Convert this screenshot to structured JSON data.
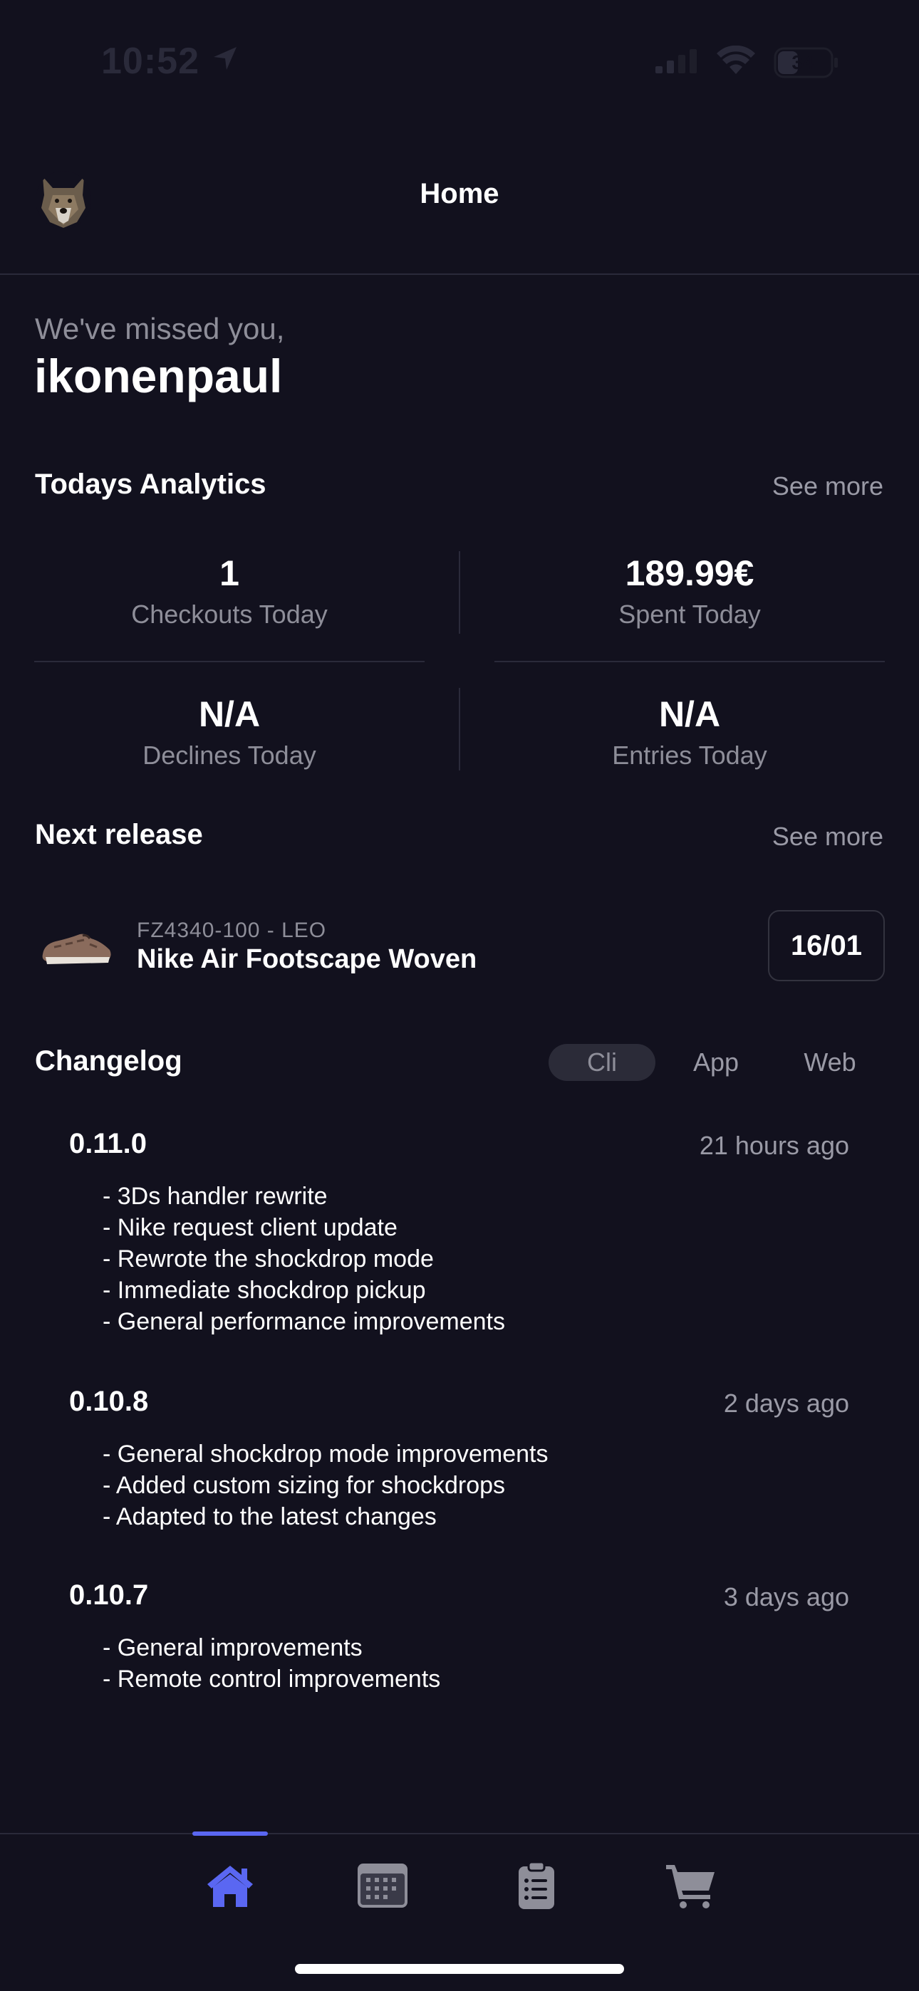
{
  "status_bar": {
    "time": "10:52",
    "battery": "34"
  },
  "header": {
    "title": "Home"
  },
  "greeting": {
    "subtitle": "We've missed you,",
    "username": "ikonenpaul"
  },
  "analytics": {
    "title": "Todays Analytics",
    "see_more": "See more",
    "stats": [
      {
        "value": "1",
        "label": "Checkouts Today"
      },
      {
        "value": "189.99€",
        "label": "Spent Today"
      },
      {
        "value": "N/A",
        "label": "Declines Today"
      },
      {
        "value": "N/A",
        "label": "Entries Today"
      }
    ]
  },
  "next_release": {
    "title": "Next release",
    "see_more": "See more",
    "sku": "FZ4340-100 - LEO",
    "name": "Nike Air Footscape Woven",
    "date": "16/01"
  },
  "changelog": {
    "title": "Changelog",
    "tabs": [
      "Cli",
      "App",
      "Web"
    ],
    "active_tab": "Cli",
    "entries": [
      {
        "version": "0.11.0",
        "time": "21 hours ago",
        "notes": [
          "- 3Ds handler rewrite",
          "- Nike request client update",
          "- Rewrote the shockdrop mode",
          "- Immediate shockdrop pickup",
          "- General performance improvements"
        ]
      },
      {
        "version": "0.10.8",
        "time": "2 days ago",
        "notes": [
          "- General shockdrop mode improvements",
          "- Added custom sizing for shockdrops",
          "- Adapted to the latest changes"
        ]
      },
      {
        "version": "0.10.7",
        "time": "3 days ago",
        "notes": [
          "- General improvements",
          "- Remote control improvements"
        ]
      }
    ]
  },
  "bottom_nav": {
    "items": [
      "home-icon",
      "calendar-icon",
      "clipboard-icon",
      "cart-icon"
    ],
    "active": "home-icon",
    "accent_color": "#5a67f2"
  }
}
